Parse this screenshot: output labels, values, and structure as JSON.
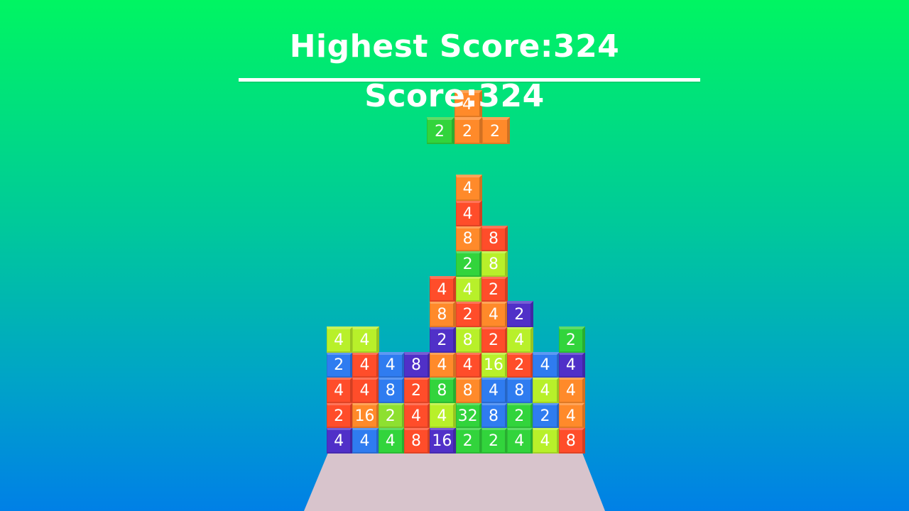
{
  "hud": {
    "highest_score_label": "Highest Score:324",
    "score_label": "Score:324"
  },
  "colors": {
    "2": "#32d43c",
    "4_orange": "#ff8a2a",
    "4_red": "#ff4d2a",
    "4_yellow": "#b8f02a",
    "8": "#ff9133",
    "16": "#7055e0",
    "32": "#8ee030",
    "blue": "#2f7cf0",
    "purple": "#5030c8",
    "floor": "#d8c4cc"
  },
  "falling_piece": {
    "blocks": [
      {
        "col": 1,
        "row": -1,
        "value": "4",
        "color": "#ff8a2a"
      },
      {
        "col": 0,
        "row": 0,
        "value": "2",
        "color": "#32d43c"
      },
      {
        "col": 1,
        "row": 0,
        "value": "2",
        "color": "#ff8a2a"
      },
      {
        "col": 2,
        "row": 0,
        "value": "2",
        "color": "#ff8a2a"
      }
    ]
  },
  "stack": {
    "columns": [
      {
        "blocks": [
          {
            "v": "4",
            "c": "#5030c8"
          },
          {
            "v": "2",
            "c": "#ff4d2a"
          },
          {
            "v": "4",
            "c": "#ff4d2a"
          },
          {
            "v": "2",
            "c": "#2f7cf0"
          },
          {
            "v": "4",
            "c": "#b8f02a"
          }
        ]
      },
      {
        "blocks": [
          {
            "v": "4",
            "c": "#2f7cf0"
          },
          {
            "v": "16",
            "c": "#ff8a2a"
          },
          {
            "v": "4",
            "c": "#ff4d2a"
          },
          {
            "v": "4",
            "c": "#ff4d2a"
          },
          {
            "v": "4",
            "c": "#b8f02a"
          }
        ]
      },
      {
        "blocks": [
          {
            "v": "4",
            "c": "#32d43c"
          },
          {
            "v": "2",
            "c": "#8ee030"
          },
          {
            "v": "8",
            "c": "#2f7cf0"
          },
          {
            "v": "4",
            "c": "#2f7cf0"
          }
        ]
      },
      {
        "blocks": [
          {
            "v": "8",
            "c": "#ff4d2a"
          },
          {
            "v": "4",
            "c": "#ff4d2a"
          },
          {
            "v": "2",
            "c": "#ff4d2a"
          },
          {
            "v": "8",
            "c": "#5030c8"
          }
        ]
      },
      {
        "blocks": [
          {
            "v": "16",
            "c": "#5030c8"
          },
          {
            "v": "4",
            "c": "#b8f02a"
          },
          {
            "v": "8",
            "c": "#32d43c"
          },
          {
            "v": "4",
            "c": "#ff8a2a"
          },
          {
            "v": "2",
            "c": "#5030c8"
          },
          {
            "v": "8",
            "c": "#ff8a2a"
          },
          {
            "v": "4",
            "c": "#ff4d2a"
          }
        ]
      },
      {
        "blocks": [
          {
            "v": "2",
            "c": "#32d43c"
          },
          {
            "v": "32",
            "c": "#32d43c"
          },
          {
            "v": "8",
            "c": "#ff8a2a"
          },
          {
            "v": "4",
            "c": "#ff4d2a"
          },
          {
            "v": "8",
            "c": "#b8f02a"
          },
          {
            "v": "2",
            "c": "#ff4d2a"
          },
          {
            "v": "4",
            "c": "#b8f02a"
          },
          {
            "v": "2",
            "c": "#32d43c"
          },
          {
            "v": "8",
            "c": "#ff8a2a"
          },
          {
            "v": "4",
            "c": "#ff4d2a"
          },
          {
            "v": "4",
            "c": "#ff8a2a"
          }
        ]
      },
      {
        "blocks": [
          {
            "v": "2",
            "c": "#32d43c"
          },
          {
            "v": "8",
            "c": "#2f7cf0"
          },
          {
            "v": "4",
            "c": "#2f7cf0"
          },
          {
            "v": "16",
            "c": "#b8f02a"
          },
          {
            "v": "2",
            "c": "#ff4d2a"
          },
          {
            "v": "4",
            "c": "#ff8a2a"
          },
          {
            "v": "2",
            "c": "#ff4d2a"
          },
          {
            "v": "8",
            "c": "#b8f02a"
          },
          {
            "v": "8",
            "c": "#ff4d2a"
          }
        ]
      },
      {
        "blocks": [
          {
            "v": "4",
            "c": "#32d43c"
          },
          {
            "v": "2",
            "c": "#32d43c"
          },
          {
            "v": "8",
            "c": "#2f7cf0"
          },
          {
            "v": "2",
            "c": "#ff4d2a"
          },
          {
            "v": "4",
            "c": "#b8f02a"
          },
          {
            "v": "2",
            "c": "#5030c8"
          }
        ]
      },
      {
        "blocks": [
          {
            "v": "4",
            "c": "#b8f02a"
          },
          {
            "v": "2",
            "c": "#2f7cf0"
          },
          {
            "v": "4",
            "c": "#b8f02a"
          },
          {
            "v": "4",
            "c": "#2f7cf0"
          }
        ]
      },
      {
        "blocks": [
          {
            "v": "8",
            "c": "#ff4d2a"
          },
          {
            "v": "4",
            "c": "#ff8a2a"
          },
          {
            "v": "4",
            "c": "#ff8a2a"
          },
          {
            "v": "4",
            "c": "#5030c8"
          },
          {
            "v": "2",
            "c": "#32d43c"
          }
        ]
      }
    ]
  }
}
